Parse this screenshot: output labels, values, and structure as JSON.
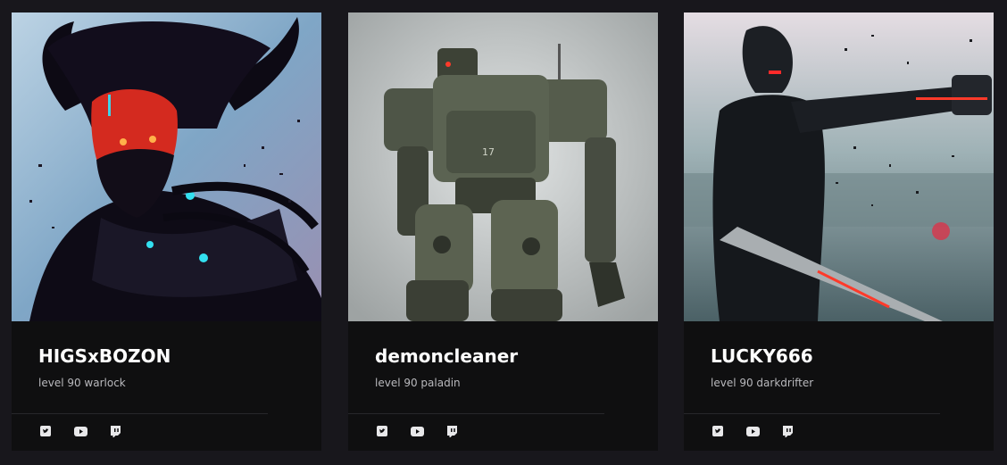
{
  "cards": [
    {
      "name": "HIGSxBOZON",
      "subtitle": "level 90 warlock",
      "art_subject": "demon-warlock-portrait",
      "socials": [
        "twitter-icon",
        "youtube-icon",
        "twitch-icon"
      ]
    },
    {
      "name": "demoncleaner",
      "subtitle": "level 90 paladin",
      "art_subject": "mech-robot-portrait",
      "socials": [
        "twitter-icon",
        "youtube-icon",
        "twitch-icon"
      ]
    },
    {
      "name": "LUCKY666",
      "subtitle": "level 90 darkdrifter",
      "art_subject": "cyborg-swordsman-portrait",
      "socials": [
        "twitter-icon",
        "youtube-icon",
        "twitch-icon"
      ]
    }
  ],
  "colors": {
    "background": "#18171c",
    "card": "#0f0f10",
    "name": "#ffffff",
    "subtitle": "#b9b9bd",
    "divider": "#27272b"
  }
}
